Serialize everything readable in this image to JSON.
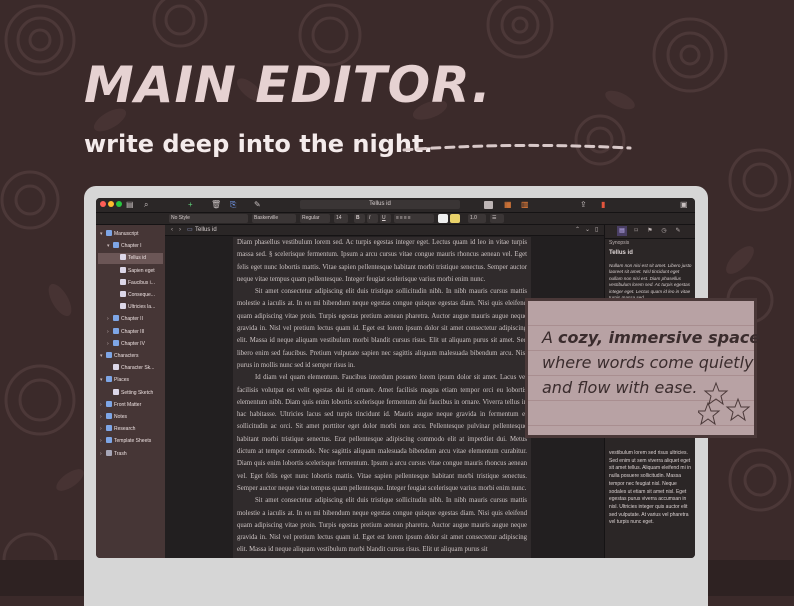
{
  "hero": {
    "title": "MAIN EDITOR.",
    "subtitle": "write deep into the night."
  },
  "colors": {
    "background": "#3b2a2a",
    "hero_title": "#e6d2d2",
    "sidebar": "#463636",
    "editor": "#221f20",
    "page": "#302b2c",
    "callout": "#b8a2a4"
  },
  "toolbar": {
    "document_title": "Tellus id",
    "icons": [
      "sidebar-icon",
      "search-icon",
      "add-icon",
      "trash-icon",
      "attachment-icon",
      "edit-icon",
      "outline-icon",
      "corkboard-icon",
      "share-icon",
      "bookmark-icon",
      "inspector-icon"
    ]
  },
  "format_bar": {
    "paragraph_style": "No Style",
    "font": "Baskerville",
    "font_weight": "Regular",
    "font_size": "14",
    "line_spacing": "1.0"
  },
  "binder": {
    "items": [
      {
        "label": "Manuscript",
        "depth": 0,
        "icon": "folder-icon",
        "expanded": true
      },
      {
        "label": "Chapter I",
        "depth": 1,
        "icon": "folder-icon",
        "expanded": true
      },
      {
        "label": "Tellus id",
        "depth": 2,
        "icon": "doc-icon",
        "selected": true
      },
      {
        "label": "Sapien eget",
        "depth": 2,
        "icon": "doc-icon"
      },
      {
        "label": "Faucibus i...",
        "depth": 2,
        "icon": "doc-icon"
      },
      {
        "label": "Conseque...",
        "depth": 2,
        "icon": "doc-icon"
      },
      {
        "label": "Ultricies la...",
        "depth": 2,
        "icon": "doc-icon"
      },
      {
        "label": "Chapter II",
        "depth": 1,
        "icon": "folder-icon",
        "collapsed": true
      },
      {
        "label": "Chapter III",
        "depth": 1,
        "icon": "folder-icon",
        "collapsed": true
      },
      {
        "label": "Chapter IV",
        "depth": 1,
        "icon": "folder-icon",
        "collapsed": true
      },
      {
        "label": "Characters",
        "depth": 0,
        "icon": "folder-icon",
        "expanded": true
      },
      {
        "label": "Character Sk...",
        "depth": 1,
        "icon": "doc-icon"
      },
      {
        "label": "Places",
        "depth": 0,
        "icon": "folder-icon",
        "expanded": true
      },
      {
        "label": "Setting Sketch",
        "depth": 1,
        "icon": "doc-icon"
      },
      {
        "label": "Front Matter",
        "depth": 0,
        "icon": "folder-icon",
        "collapsed": true
      },
      {
        "label": "Notes",
        "depth": 0,
        "icon": "folder-icon",
        "collapsed": true
      },
      {
        "label": "Research",
        "depth": 0,
        "icon": "folder-icon",
        "collapsed": true
      },
      {
        "label": "Template Sheets",
        "depth": 0,
        "icon": "folder-icon",
        "collapsed": true
      },
      {
        "label": "Trash",
        "depth": 0,
        "icon": "trash-icon",
        "collapsed": true
      }
    ]
  },
  "editor": {
    "header_title": "Tellus id",
    "paragraphs": [
      "Diam phasellus vestibulum lorem sed. Ac turpis egestas integer eget. Lectus quam id leo in vitae turpis massa sed. § scelerisque fermentum. Ipsum a arcu cursus vitae congue mauris rhoncus aenean vel. Eget felis eget nunc lobortis mattis. Vitae sapien pellentesque habitant morbi tristique senectus. Semper auctor neque vitae tempus quam pellentesque. Integer feugiat scelerisque varius morbi enim nunc.",
      "Sit amet consectetur adipiscing elit duis tristique sollicitudin nibh. In nibh mauris cursus mattis molestie a iaculis at. In eu mi bibendum neque egestas congue quisque egestas diam. Nisi quis eleifend quam adipiscing vitae proin. Turpis egestas pretium aenean pharetra. Auctor augue mauris augue neque gravida in. Nisl vel pretium lectus quam id. Eget est lorem ipsum dolor sit amet consectetur adipiscing elit. Massa id neque aliquam vestibulum morbi blandit cursus risus. Elit ut aliquam purus sit amet. Sed libero enim sed faucibus. Pretium vulputate sapien nec sagittis aliquam malesuada bibendum arcu. Nisl purus in mollis nunc sed id semper risus in.",
      "Id diam vel quam elementum. Faucibus interdum posuere lorem ipsum dolor sit amet. Lacus vel facilisis volutpat est velit egestas dui id ornare. Amet facilisis magna etiam tempor orci eu lobortis elementum nibh. Diam quis enim lobortis scelerisque fermentum dui faucibus in ornare. Viverra tellus in hac habitasse. Ultricies lacus sed turpis tincidunt id. Mauris augue neque gravida in fermentum et sollicitudin ac orci. Sit amet porttitor eget dolor morbi non arcu. Pellentesque pulvinar pellentesque habitant morbi tristique senectus. Erat pellentesque adipiscing commodo elit at imperdiet dui. Metus dictum at tempor commodo. Nec sagittis aliquam malesuada bibendum arcu vitae elementum curabitur. Diam quis enim lobortis scelerisque fermentum. Ipsum a arcu cursus vitae congue mauris rhoncus aenean vel. Eget felis eget nunc lobortis mattis. Vitae sapien pellentesque habitant morbi tristique senectus. Semper auctor neque vitae tempus quam pellentesque. Integer feugiat scelerisque varius morbi enim nunc.",
      "Sit amet consectetur adipiscing elit duis tristique sollicitudin nibh. In nibh mauris cursus mattis molestie a iaculis at. In eu mi bibendum neque egestas congue quisque egestas diam. Nisi quis eleifend quam adipiscing vitae proin. Turpis egestas pretium aenean pharetra. Auctor augue mauris augue neque gravida in. Nisl vel pretium lectus quam id. Eget est lorem ipsum dolor sit amet consectetur adipiscing elit. Massa id neque aliquam vestibulum morbi blandit cursus risus. Elit ut aliquam purus sit"
    ]
  },
  "inspector": {
    "section": "Synopsis",
    "title": "Tellus id",
    "synopsis": "Nullam non nisi est sit amet. Libero justo laoreet sit amet. Nisl tincidunt eget nullam non nisi est. Diam phasellus vestibulum lorem sed. Ac turpis egestas integer eget. Lectus quam id leo in vitae turpis massa sed.",
    "notes": "vestibulum lorem sed risus ultricies. Sed enim ut sem viverra aliquet eget sit amet tellus. Aliquam eleifend mi in nulla posuere sollicitudin. Massa tempor nec feugiat nisl. Neque sodales ut etiam sit amet nisl. Eget egestas purus viverra accumsan in nisl. Ultricies integer quis auctor elit sed vulputate. At varius vel pharetra vel turpis nunc eget."
  },
  "callout": {
    "line1_prefix": "A ",
    "line1_emphasis": "cozy, immersive space",
    "line2": "where words come quietly",
    "line3": "and flow with ease."
  }
}
